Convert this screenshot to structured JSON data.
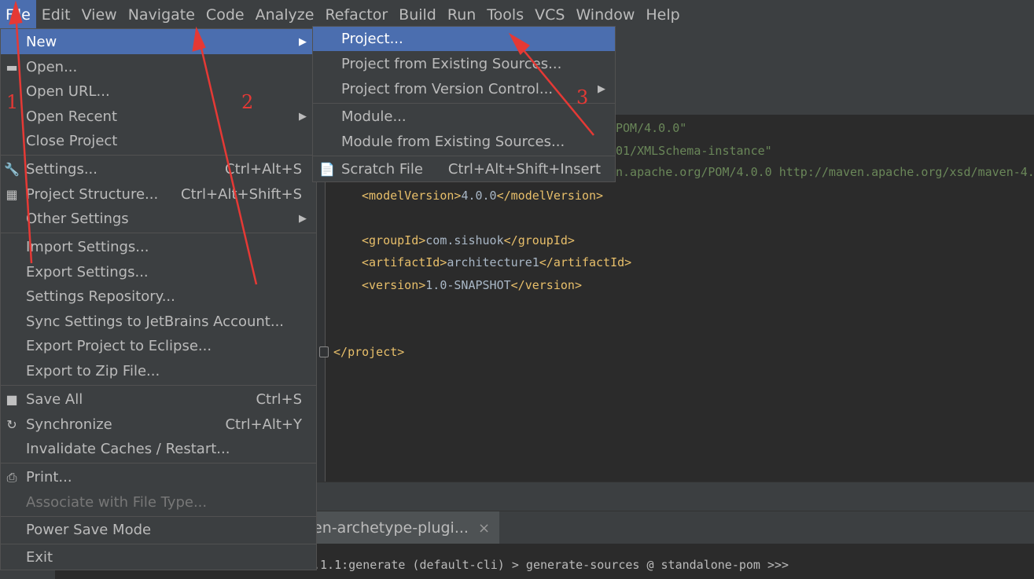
{
  "menubar": [
    "File",
    "Edit",
    "View",
    "Navigate",
    "Code",
    "Analyze",
    "Refactor",
    "Build",
    "Run",
    "Tools",
    "VCS",
    "Window",
    "Help"
  ],
  "file_menu": {
    "new": "New",
    "open": "Open...",
    "open_url": "Open URL...",
    "open_recent": "Open Recent",
    "close_project": "Close Project",
    "settings": "Settings...",
    "settings_sc": "Ctrl+Alt+S",
    "project_structure": "Project Structure...",
    "project_structure_sc": "Ctrl+Alt+Shift+S",
    "other_settings": "Other Settings",
    "import_settings": "Import Settings...",
    "export_settings": "Export Settings...",
    "settings_repository": "Settings Repository...",
    "sync_settings": "Sync Settings to JetBrains Account...",
    "export_eclipse": "Export Project to Eclipse...",
    "export_zip": "Export to Zip File...",
    "save_all": "Save All",
    "save_all_sc": "Ctrl+S",
    "synchronize": "Synchronize",
    "synchronize_sc": "Ctrl+Alt+Y",
    "invalidate": "Invalidate Caches / Restart...",
    "print": "Print...",
    "associate": "Associate with File Type...",
    "power_save": "Power Save Mode",
    "exit": "Exit"
  },
  "new_menu": {
    "project": "Project...",
    "project_existing": "Project from Existing Sources...",
    "project_vcs": "Project from Version Control...",
    "module": "Module...",
    "module_existing": "Module from Existing Sources...",
    "scratch": "Scratch File",
    "scratch_sc": "Ctrl+Alt+Shift+Insert"
  },
  "editor": {
    "line1": "POM/4.0.0\"",
    "line2": "01/XMLSchema-instance\"",
    "line3": "n.apache.org/POM/4.0.0 http://maven.apache.org/xsd/maven-4.",
    "model_version": "4.0.0",
    "group_id": "com.sishuok",
    "artifact_id": "architecture1",
    "version": "1.0-SNAPSHOT",
    "tag_model_version": "modelVersion",
    "tag_group_id": "groupId",
    "tag_artifact_id": "artifactId",
    "tag_version": "version",
    "tag_project": "project"
  },
  "run_tab": {
    "label": "en-archetype-plugi...",
    "close": "×"
  },
  "console": {
    "line": ".1.1:generate (default-cli) > generate-sources @ standalone-pom >>>"
  },
  "annotations": [
    "1",
    "2",
    "3"
  ],
  "colors": {
    "selection": "#4b6eaf",
    "annotation": "#e53935",
    "menu_bg": "#3c3f41"
  }
}
